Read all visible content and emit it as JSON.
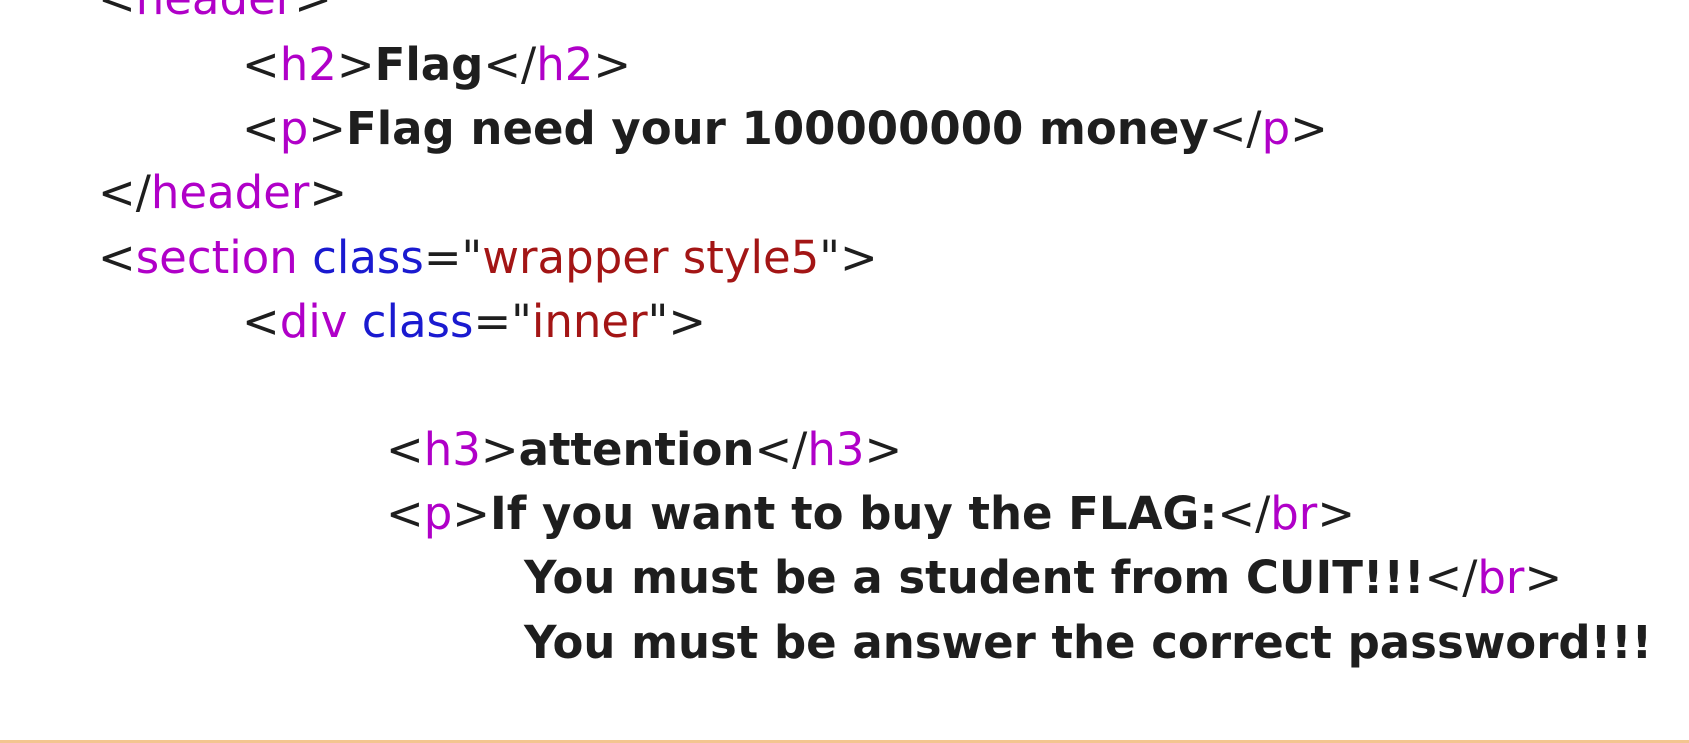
{
  "colors": {
    "punctuation": "#1e1e1e",
    "tag_name": "#b000c8",
    "attribute_name": "#1a1ad0",
    "attribute_value": "#a31515",
    "text_content": "#1e1e1e",
    "bottom_border": "#f3c590"
  },
  "lines": {
    "header_open": {
      "lt": "<",
      "tag": "header",
      "gt": ">"
    },
    "h2": {
      "lt": "<",
      "tag": "h2",
      "gt": ">",
      "text": "Flag",
      "close_lt": "</",
      "close_tag": "h2",
      "close_gt": ">"
    },
    "p1": {
      "lt": "<",
      "tag": "p",
      "gt": ">",
      "text": "Flag need your 100000000 money",
      "close_lt": "</",
      "close_tag": "p",
      "close_gt": ">"
    },
    "header_close": {
      "lt": "</",
      "tag": "header",
      "gt": ">"
    },
    "section": {
      "lt": "<",
      "tag": "section",
      "space": " ",
      "attr": "class",
      "eq": "=",
      "q1": "\"",
      "value": "wrapper style5",
      "q2": "\"",
      "gt": ">"
    },
    "div": {
      "lt": "<",
      "tag": "div",
      "space": " ",
      "attr": "class",
      "eq": "=",
      "q1": "\"",
      "value": "inner",
      "q2": "\"",
      "gt": ">"
    },
    "h3": {
      "lt": "<",
      "tag": "h3",
      "gt": ">",
      "text": "attention",
      "close_lt": "</",
      "close_tag": "h3",
      "close_gt": ">"
    },
    "p2": {
      "lt": "<",
      "tag": "p",
      "gt": ">",
      "text": "If you want to buy the FLAG:",
      "br_lt": "</",
      "br_tag": "br",
      "br_gt": ">"
    },
    "p2_line2": {
      "text": "You must be a student from CUIT!!!",
      "br_lt": "</",
      "br_tag": "br",
      "br_gt": ">"
    },
    "p2_line3": {
      "text": "You must be answer the correct password!!!"
    }
  }
}
